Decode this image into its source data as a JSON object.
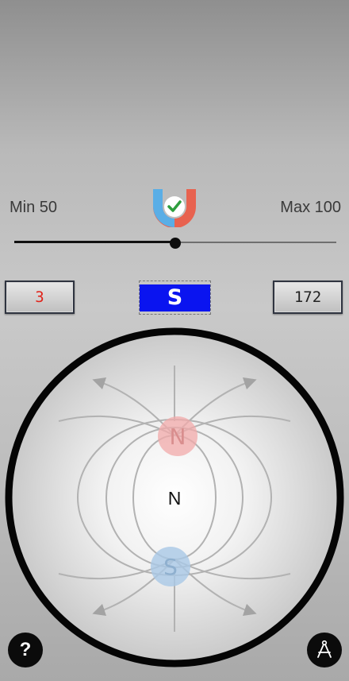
{
  "range": {
    "min_label": "Min 50",
    "max_label": "Max 100"
  },
  "slider": {
    "value_fraction": 0.5
  },
  "readouts": {
    "left": "3",
    "pole": "S",
    "right": "172"
  },
  "field": {
    "center_label": "N",
    "top_pole": "N",
    "bottom_pole": "S"
  },
  "help": {
    "label": "?"
  },
  "icons": {
    "logo": "magnet-check-icon",
    "calibrate": "compass-drafting-icon"
  },
  "colors": {
    "pole_indicator": "#0a14f0",
    "left_readout_text": "#e0241b",
    "north_pole": "#f2a9a9",
    "south_pole": "#a9c8e6"
  }
}
